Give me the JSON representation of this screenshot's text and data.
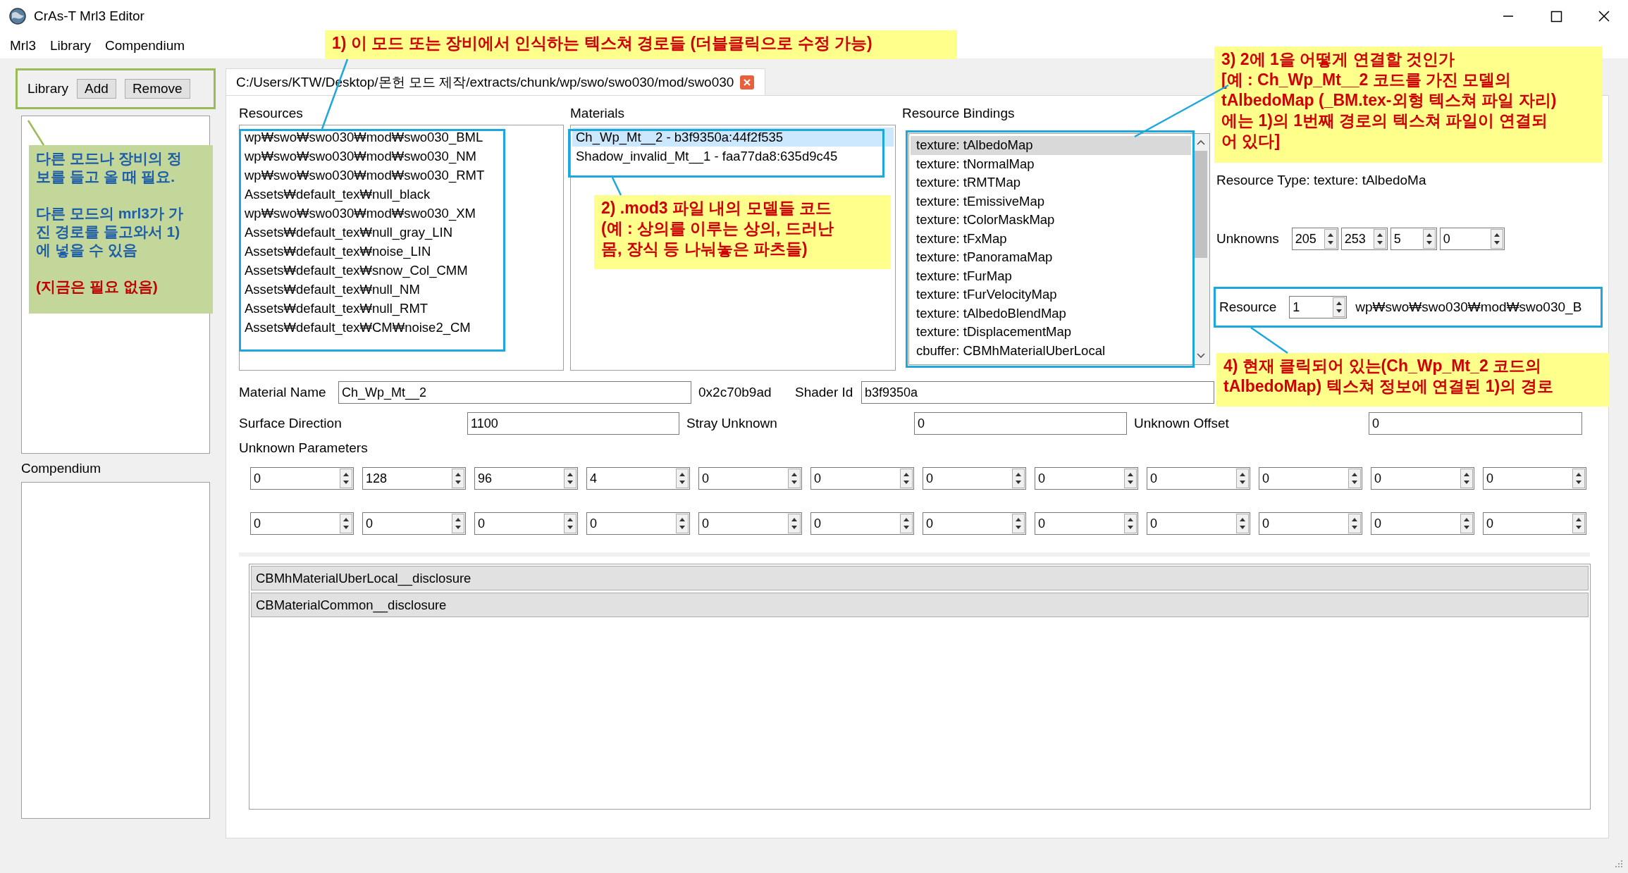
{
  "window": {
    "title": "CrAs-T Mrl3 Editor"
  },
  "menu": [
    "Mrl3",
    "Library",
    "Compendium"
  ],
  "library": {
    "label": "Library",
    "buttons": [
      "Add",
      "Remove"
    ]
  },
  "compendium": {
    "label": "Compendium"
  },
  "tabs": [
    {
      "label": "C:/Users/KTW/Desktop/몬헌 모드 제작/extracts/chunk/wp/swo/swo030/mod/swo030",
      "selected": true
    }
  ],
  "resources": {
    "label": "Resources",
    "items": [
      "wp₩swo₩swo030₩mod₩swo030_BML",
      "wp₩swo₩swo030₩mod₩swo030_NM",
      "wp₩swo₩swo030₩mod₩swo030_RMT",
      "Assets₩default_tex₩null_black",
      "wp₩swo₩swo030₩mod₩swo030_XM",
      "Assets₩default_tex₩null_gray_LIN",
      "Assets₩default_tex₩noise_LIN",
      "Assets₩default_tex₩snow_Col_CMM",
      "Assets₩default_tex₩null_NM",
      "Assets₩default_tex₩null_RMT",
      "Assets₩default_tex₩CM₩noise2_CM"
    ]
  },
  "materials": {
    "label": "Materials",
    "items": [
      {
        "text": "Ch_Wp_Mt__2 - b3f9350a:44f2f535",
        "selected": true
      },
      {
        "text": "Shadow_invalid_Mt__1 - faa77da8:635d9c45",
        "selected": false
      }
    ]
  },
  "resource_bindings": {
    "label": "Resource Bindings",
    "items": [
      {
        "text": "texture: tAlbedoMap",
        "selected": true
      },
      {
        "text": "texture: tNormalMap",
        "selected": false
      },
      {
        "text": "texture: tRMTMap",
        "selected": false
      },
      {
        "text": "texture: tEmissiveMap",
        "selected": false
      },
      {
        "text": "texture: tColorMaskMap",
        "selected": false
      },
      {
        "text": "texture: tFxMap",
        "selected": false
      },
      {
        "text": "texture: tPanoramaMap",
        "selected": false
      },
      {
        "text": "texture: tFurMap",
        "selected": false
      },
      {
        "text": "texture: tFurVelocityMap",
        "selected": false
      },
      {
        "text": "texture: tAlbedoBlendMap",
        "selected": false
      },
      {
        "text": "texture: tDisplacementMap",
        "selected": false
      },
      {
        "text": "cbuffer: CBMhMaterialUberLocal",
        "selected": false
      }
    ]
  },
  "resource_type": "Resource Type: texture: tAlbedoMa",
  "unknowns": {
    "label": "Unknowns",
    "values": [
      "205",
      "253",
      "5",
      "0"
    ]
  },
  "resource": {
    "label": "Resource",
    "index": "1",
    "path": "wp₩swo₩swo030₩mod₩swo030_B"
  },
  "material_name": {
    "label": "Material Name",
    "value": "Ch_Wp_Mt__2",
    "hash": "0x2c70b9ad"
  },
  "shader_id": {
    "label": "Shader Id",
    "value": "b3f9350a"
  },
  "surface_direction": {
    "label": "Surface Direction",
    "value": "1100"
  },
  "stray_unknown": {
    "label": "Stray Unknown",
    "value": "0"
  },
  "unknown_offset": {
    "label": "Unknown Offset",
    "value": "0"
  },
  "unknown_parameters": {
    "label": "Unknown Parameters",
    "rows": [
      [
        "0",
        "128",
        "96",
        "4",
        "0",
        "0",
        "0",
        "0",
        "0",
        "0",
        "0",
        "0"
      ],
      [
        "0",
        "0",
        "0",
        "0",
        "0",
        "0",
        "0",
        "0",
        "0",
        "0",
        "0",
        "0"
      ]
    ]
  },
  "disclosures": [
    "CBMhMaterialUberLocal__disclosure",
    "CBMaterialCommon__disclosure"
  ],
  "side_note": {
    "paragraphs": [
      {
        "kind": "info",
        "lines": [
          "다른 모드나 장비의 정",
          "보를 들고 올 때 필요."
        ]
      },
      {
        "kind": "info",
        "lines": [
          "다른 모드의 mrl3가 가",
          "진 경로를 들고와서 1)",
          "에 넣을 수 있음"
        ]
      },
      {
        "kind": "warning",
        "lines": [
          "(지금은 필요 없음)"
        ]
      }
    ]
  },
  "annotations": [
    {
      "lines": [
        "1) 이 모드 또는 장비에서 인식하는 텍스쳐 경로들 (더블클릭으로 수정 가능)"
      ]
    },
    {
      "lines": [
        "2) .mod3 파일 내의 모델들 코드",
        "(예 : 상의를 이루는 상의, 드러난",
        "몸, 장식 등 나눠놓은 파츠들)"
      ]
    },
    {
      "lines": [
        "3) 2에 1을 어떻게 연결할 것인가",
        "[예 : Ch_Wp_Mt__2 코드를 가진 모델의",
        "tAlbedoMap (_BM.tex-외형 텍스쳐 파일 자리)",
        "에는 1)의 1번째 경로의 텍스쳐 파일이 연결되",
        "어 있다]"
      ]
    },
    {
      "lines": [
        "4) 현재 클릭되어 있는(Ch_Wp_Mt_2 코드의",
        "tAlbedoMap) 텍스쳐 정보에 연결된 1)의 경로"
      ]
    }
  ]
}
